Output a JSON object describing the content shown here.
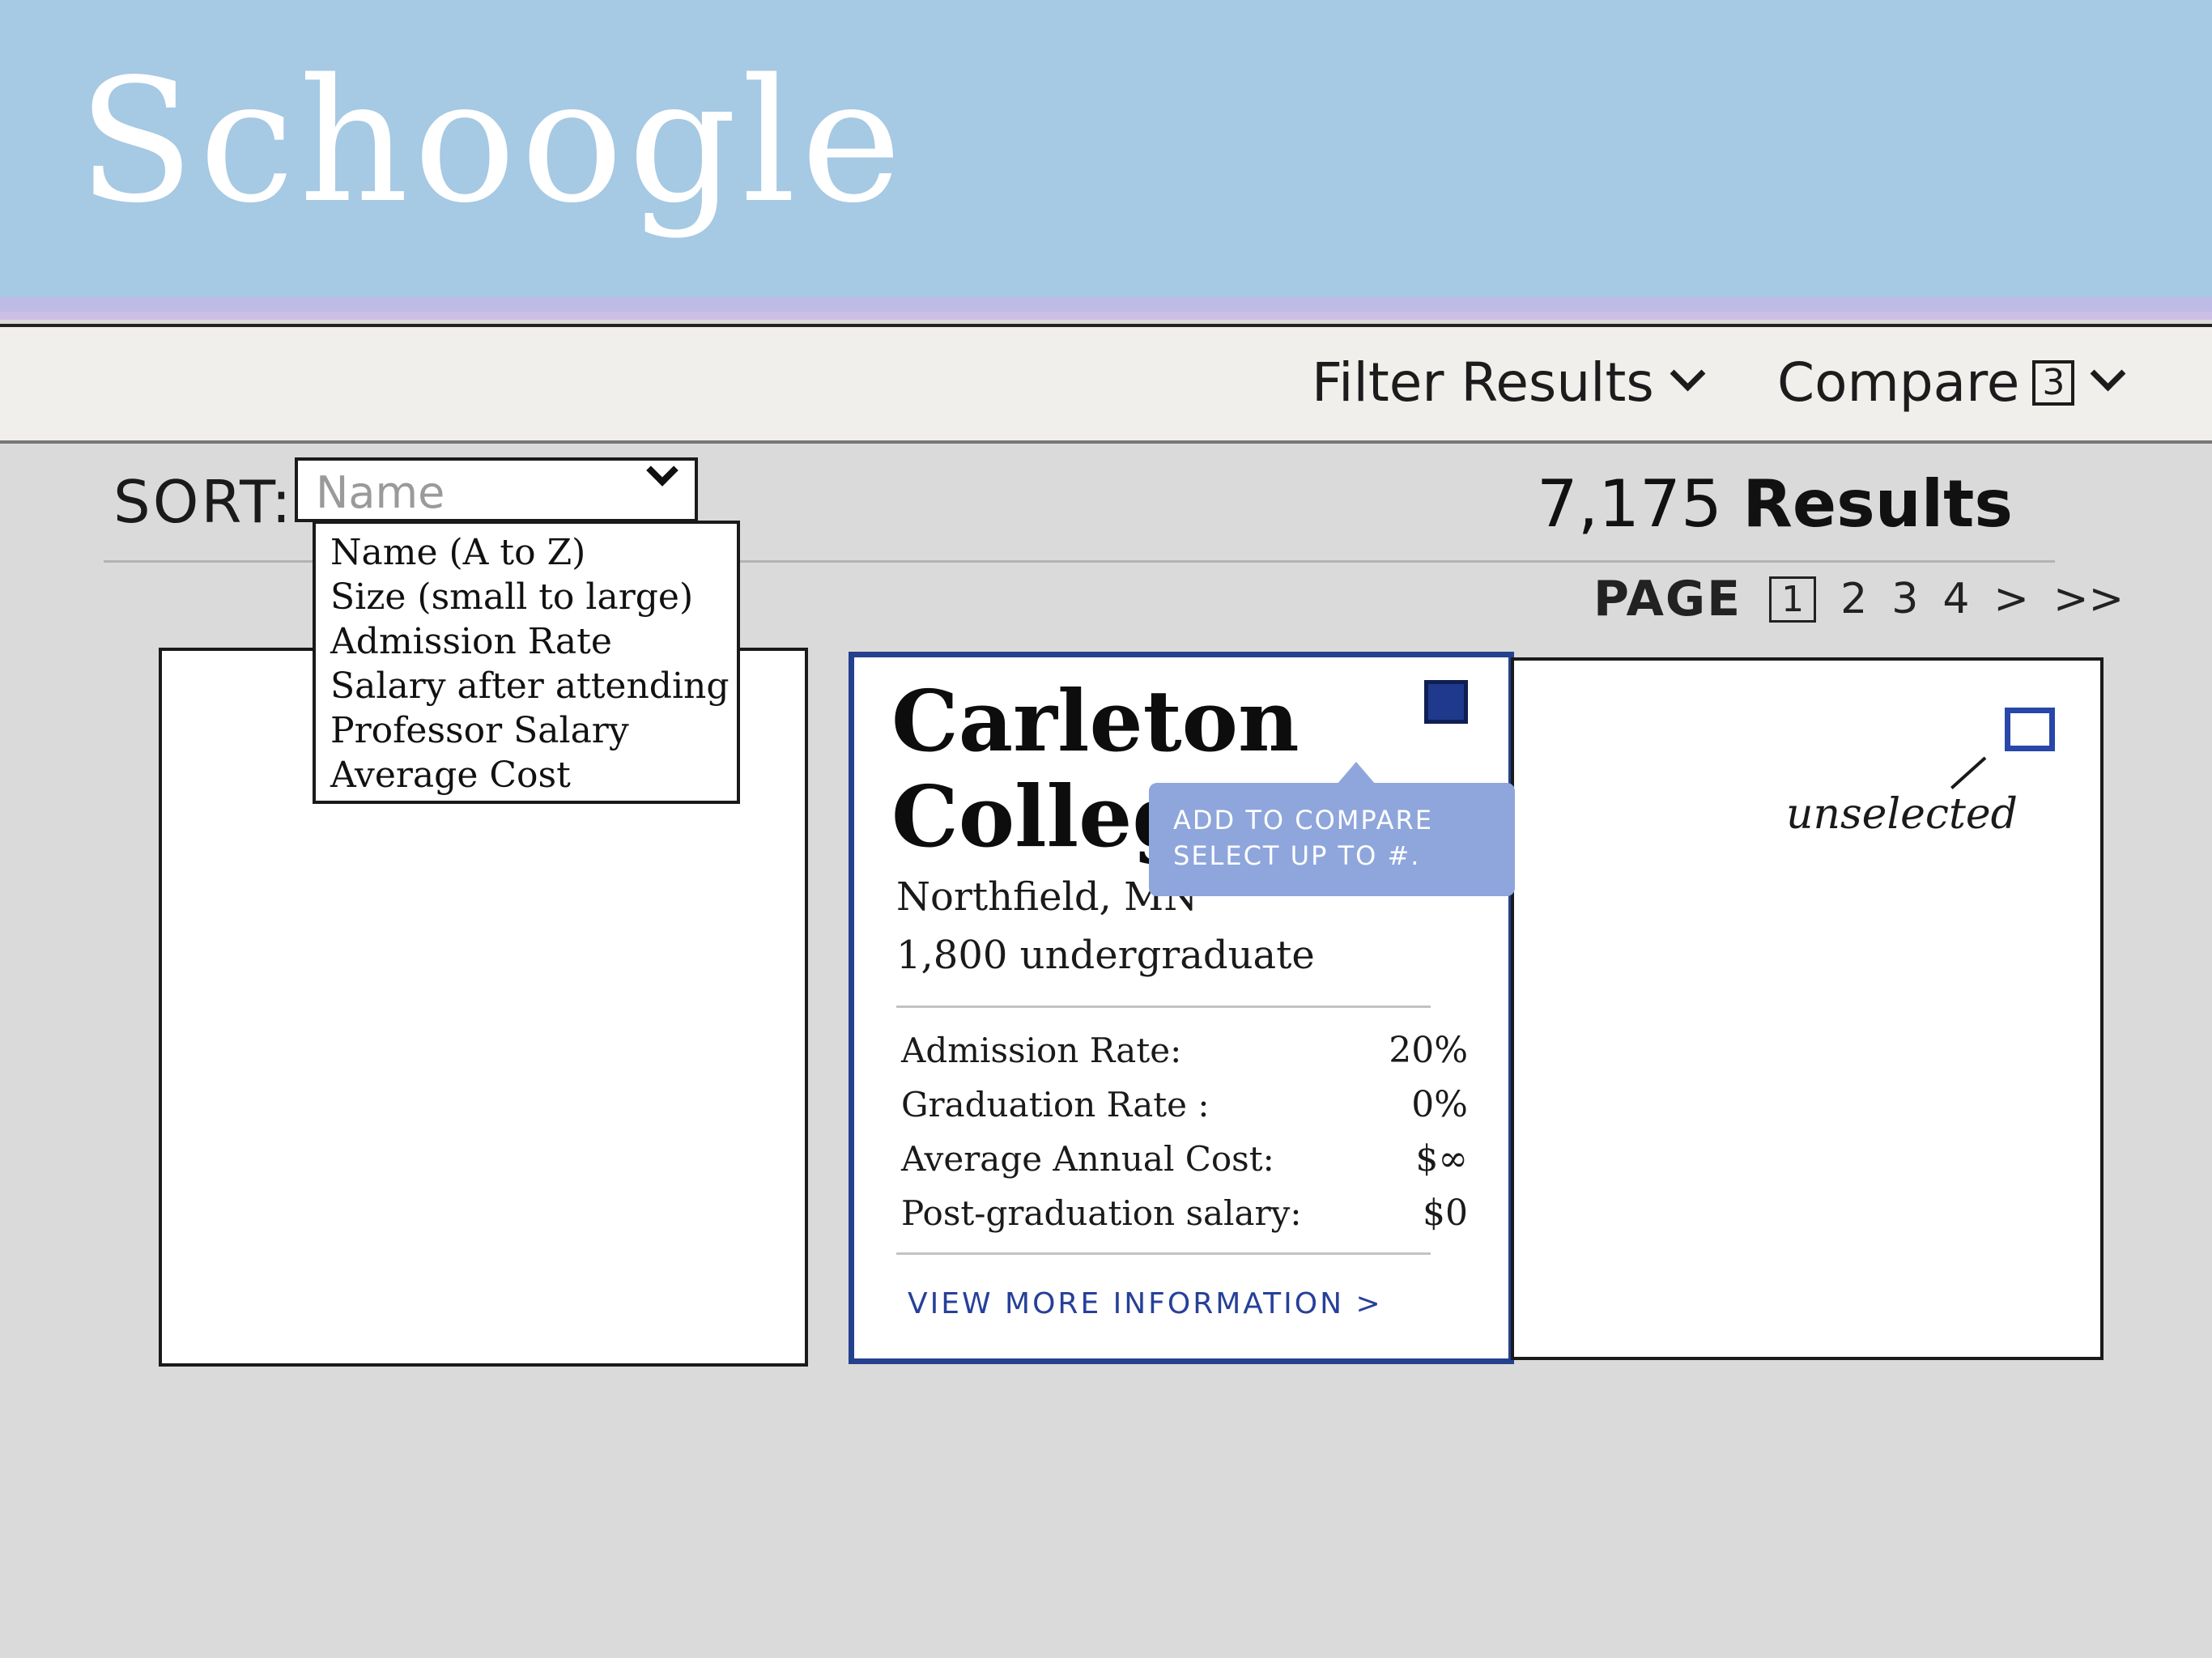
{
  "app": {
    "name": "Schoogle"
  },
  "nav": {
    "filter_label": "Filter Results",
    "compare_label": "Compare",
    "compare_count": "3"
  },
  "sort": {
    "label": "SORT:",
    "placeholder": "Name",
    "options": [
      "Name (A to Z)",
      "Size (small to large)",
      "Admission Rate",
      "Salary after attending",
      "Professor Salary",
      "Average Cost"
    ]
  },
  "results": {
    "count": "7,175",
    "label": "Results"
  },
  "pagination": {
    "label": "PAGE",
    "current": "1",
    "pages": [
      "2",
      "3",
      "4"
    ],
    "next": ">",
    "last": ">>"
  },
  "cards": {
    "featured": {
      "name": "Carleton\nCollege",
      "location": "Northfield, MN",
      "enrollment": "1,800 undergraduate",
      "tooltip": {
        "line1": "ADD TO COMPARE",
        "line2": "SELECT UP TO #."
      },
      "stats": [
        {
          "label": "Admission Rate:",
          "value": "20%"
        },
        {
          "label": "Graduation Rate :",
          "value": "0%"
        },
        {
          "label": "Average Annual Cost:",
          "value": "$∞"
        },
        {
          "label": "Post-graduation salary:",
          "value": "$0"
        }
      ],
      "link": "VIEW MORE INFORMATION >"
    },
    "right": {
      "annotation": "unselected"
    }
  },
  "colors": {
    "header": "#a6c9e4",
    "selected": "#24408e",
    "tooltip": "#8fa6dc",
    "background": "#dadada"
  }
}
